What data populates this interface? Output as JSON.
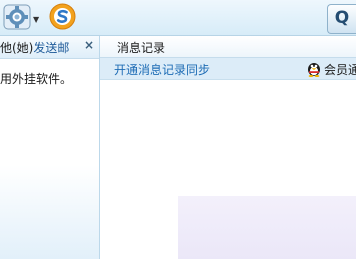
{
  "toolbar": {
    "gear_icon": "gear-menu-icon",
    "sogou_icon": "sogou-s-icon",
    "search_label": "Q"
  },
  "left_panel": {
    "header_prefix": "他(她)",
    "header_send": "发送邮",
    "close_label": "×",
    "notice": "用外挂软件。"
  },
  "right_panel": {
    "tab_label": "消息记录",
    "sync_link": "开通消息记录同步",
    "vip_label": "会员通"
  },
  "colors": {
    "link": "#1e6cb5",
    "sync_bar": "#dcecf8",
    "lavender_block": "#ebe7f8"
  }
}
